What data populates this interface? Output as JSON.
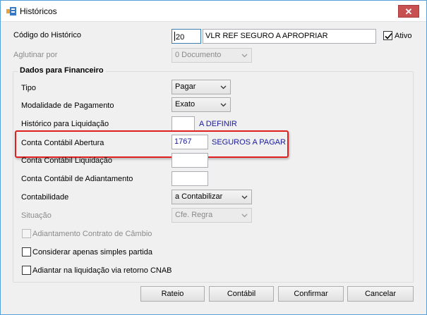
{
  "window": {
    "title": "Históricos",
    "close_label": "✕"
  },
  "form": {
    "codigo": {
      "label": "Código do Histórico",
      "value": "20",
      "description": "VLR REF SEGURO A APROPRIAR"
    },
    "ativo": {
      "label": "Ativo",
      "checked": true
    },
    "aglutinar": {
      "label": "Aglutinar por",
      "value": "0 Documento"
    }
  },
  "financeiro": {
    "title": "Dados para Financeiro",
    "tipo": {
      "label": "Tipo",
      "value": "Pagar"
    },
    "modalidade": {
      "label": "Modalidade de Pagamento",
      "value": "Exato"
    },
    "hist_liquidacao": {
      "label": "Histórico para Liquidação",
      "value": "",
      "description": "A DEFINIR"
    },
    "conta_abertura": {
      "label": "Conta Contábil Abertura",
      "value": "1767",
      "description": "SEGUROS A PAGAR"
    },
    "conta_liquidacao": {
      "label": "Conta Contábil Liquidação",
      "value": ""
    },
    "conta_adiantamento": {
      "label": "Conta Contábil de Adiantamento",
      "value": ""
    },
    "contabilidade": {
      "label": "Contabilidade",
      "value": "a Contabilizar"
    },
    "situacao": {
      "label": "Situação",
      "value": "Cfe. Regra"
    },
    "adiantamento_cambio": {
      "label": "Adiantamento Contrato de Câmbio",
      "checked": false
    },
    "simples_partida": {
      "label": "Considerar apenas simples partida",
      "checked": false
    },
    "adiantar_cnab": {
      "label": "Adiantar na liquidação via retorno CNAB",
      "checked": false
    }
  },
  "buttons": {
    "rateio": "Rateio",
    "contabil": "Contábil",
    "confirmar": "Confirmar",
    "cancelar": "Cancelar"
  }
}
